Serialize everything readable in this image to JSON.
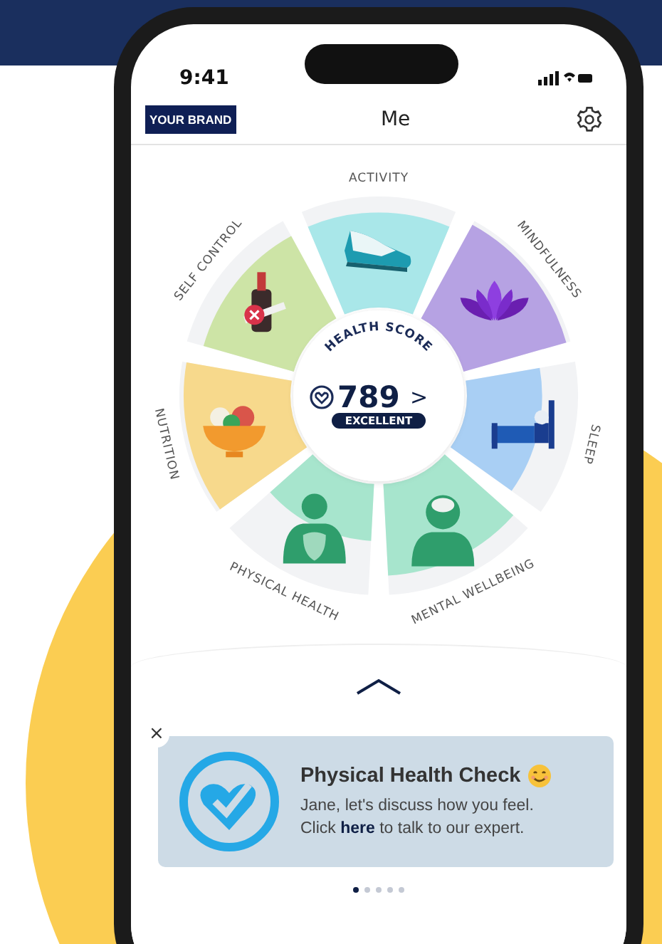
{
  "status_bar": {
    "time": "9:41"
  },
  "header": {
    "brand": "YOUR BRAND",
    "title": "Me"
  },
  "wheel": {
    "center_title": "HEALTH SCORE",
    "score": "789",
    "score_arrow": ">",
    "rating": "EXCELLENT",
    "segments": [
      {
        "label": "ACTIVITY",
        "kind": "activity",
        "color": "#a9e7e9",
        "level": 0.92
      },
      {
        "label": "MINDFULNESS",
        "kind": "mindfulness",
        "color": "#b6a2e3",
        "level": 1
      },
      {
        "label": "SLEEP",
        "kind": "sleep",
        "color": "#a9cff4",
        "level": 0.82
      },
      {
        "label": "MENTAL WELLBEING",
        "kind": "mental",
        "color": "#a7e5cd",
        "level": 0.9
      },
      {
        "label": "PHYSICAL HEALTH",
        "kind": "physical",
        "color": "#a7e5cd",
        "level": 0.72
      },
      {
        "label": "NUTRITION",
        "kind": "nutrition",
        "color": "#f7d98c",
        "level": 1
      },
      {
        "label": "SELF CONTROL",
        "kind": "selfcontrol",
        "color": "#cde4a6",
        "level": 0.9
      }
    ]
  },
  "card": {
    "close": "×",
    "title": "Physical Health Check",
    "text_before": "Jane, let's discuss how you feel. Click ",
    "link": "here",
    "text_after": " to talk to our expert."
  },
  "pager": {
    "dots": [
      {
        "selected": true
      },
      {
        "selected": false
      },
      {
        "selected": false
      },
      {
        "selected": false
      },
      {
        "selected": false
      }
    ]
  }
}
